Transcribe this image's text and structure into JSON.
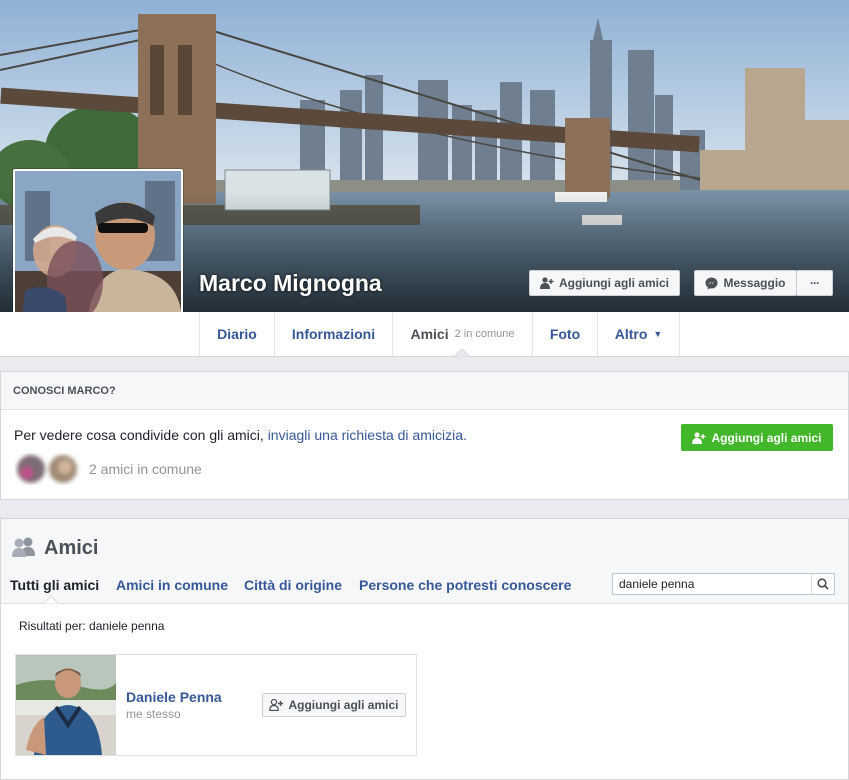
{
  "profile": {
    "name": "Marco Mignogna",
    "add_friend_label": "Aggiungi agli amici",
    "message_label": "Messaggio",
    "more_label": "···"
  },
  "nav": {
    "tabs": [
      {
        "label": "Diario"
      },
      {
        "label": "Informazioni"
      },
      {
        "label": "Amici",
        "sub": "2 in comune"
      },
      {
        "label": "Foto"
      },
      {
        "label": "Altro"
      }
    ]
  },
  "conosci": {
    "title": "CONOSCI MARCO?",
    "text": "Per vedere cosa condivide con gli amici, ",
    "link": "inviagli una richiesta di amicizia.",
    "mutual_count": "2 amici in comune",
    "add_button": "Aggiungi agli amici"
  },
  "amici": {
    "title": "Amici",
    "tabs": [
      "Tutti gli amici",
      "Amici in comune",
      "Città di origine",
      "Persone che potresti conoscere"
    ],
    "search_value": "daniele penna",
    "results_label": "Risultati per: daniele penna",
    "friend": {
      "name": "Daniele Penna",
      "subtitle": "me stesso",
      "add_button": "Aggiungi agli amici"
    }
  },
  "colors": {
    "link_blue": "#365899",
    "green": "#42b72a",
    "border": "#d3d6db"
  }
}
